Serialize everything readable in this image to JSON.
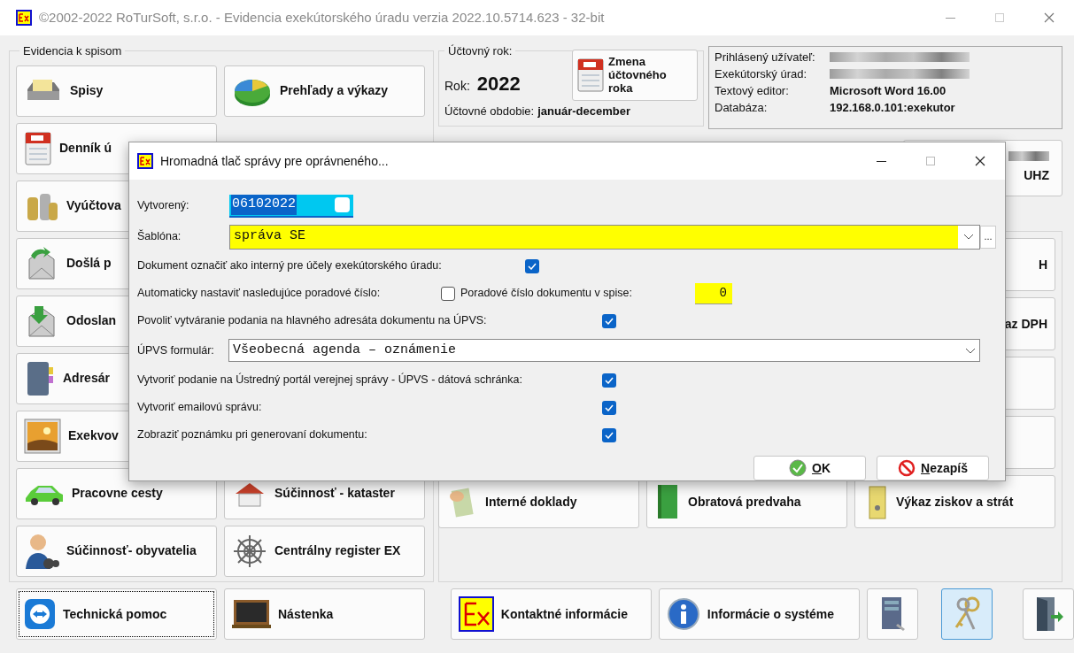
{
  "window": {
    "title": "©2002-2022 RoTurSoft, s.r.o. - Evidencia exekútorského úradu verzia 2022.10.5714.623 - 32-bit"
  },
  "file_group": {
    "title": "Evidencia k spisom",
    "buttons": [
      {
        "label": "Spisy"
      },
      {
        "label": "Prehľady a výkazy"
      },
      {
        "label": "Denník ú"
      },
      {
        "label": "Vyúčtova"
      },
      {
        "label": "Došlá p"
      },
      {
        "label": "Odoslan"
      },
      {
        "label": "Adresár"
      },
      {
        "label": "Exekvov"
      },
      {
        "label": "Pracovne cesty"
      },
      {
        "label": "Súčinnosť - kataster"
      },
      {
        "label": "Súčinnosť- obyvatelia"
      },
      {
        "label": "Centrálny register EX"
      }
    ]
  },
  "year_group": {
    "title": "Účtovný rok:",
    "year_label": "Rok:",
    "year": "2022",
    "period_label": "Účtovné obdobie:",
    "period": "január-december",
    "change_button": "Zmena účtovného roka"
  },
  "info": [
    {
      "label": "Prihlásený užívateľ:"
    },
    {
      "label": "Exekútorský úrad:"
    },
    {
      "label": "Textový editor:",
      "value": "Microsoft Word 16.00"
    },
    {
      "label": "Databáza:",
      "value": "192.168.0.101:exekutor"
    }
  ],
  "right_panel": {
    "top_button": "UHZ",
    "side_buttons": [
      {
        "label": "H"
      },
      {
        "label": "az DPH"
      }
    ],
    "buttons": [
      {
        "label": "Interné doklady"
      },
      {
        "label": "Obratová predvaha"
      },
      {
        "label": "Výkaz ziskov a strát"
      }
    ]
  },
  "bottom_bar": [
    {
      "label": "Technická pomoc",
      "focused": true,
      "selected": false
    },
    {
      "label": "Nástenka",
      "focused": false,
      "selected": false
    },
    {
      "label": "Kontaktné informácie",
      "focused": false,
      "selected": false
    },
    {
      "label": "Informácie o systéme",
      "focused": false,
      "selected": false
    },
    {
      "focused": false,
      "selected": false
    },
    {
      "focused": false,
      "selected": true
    },
    {
      "focused": false,
      "selected": false
    }
  ],
  "dialog": {
    "title": "Hromadná tlač správy pre oprávneného...",
    "created": {
      "label": "Vytvorený:",
      "value": "06102022"
    },
    "template": {
      "label": "Šablóna:",
      "value": "správa SE",
      "more_button": "..."
    },
    "rows": [
      {
        "kind": "check",
        "label": "Dokument označiť ako interný pre účely exekútorského úradu:",
        "checked": true
      },
      {
        "kind": "number",
        "label": "Automaticky nastaviť nasledujúce poradové číslo:",
        "checked": false,
        "number_label": "Poradové číslo dokumentu v spise:",
        "number": "0"
      },
      {
        "kind": "check",
        "label": "Povoliť vytváranie podania na hlavného adresáta dokumentu na ÚPVS:",
        "checked": true
      },
      {
        "kind": "select",
        "label": "ÚPVS formulár:",
        "value": "Všeobecná agenda – oznámenie"
      },
      {
        "kind": "check",
        "label": "Vytvoriť podanie na Ústredný portál verejnej správy - ÚPVS - dátová schránka:",
        "checked": true
      },
      {
        "kind": "check",
        "label": "Vytvoriť emailovú správu:",
        "checked": true
      },
      {
        "kind": "check",
        "label": "Zobraziť poznámku pri generovaní dokumentu:",
        "checked": true
      }
    ],
    "buttons": [
      {
        "label": "OK",
        "kind": "ok"
      },
      {
        "label": "Nezapíš",
        "kind": "cancel"
      }
    ]
  }
}
